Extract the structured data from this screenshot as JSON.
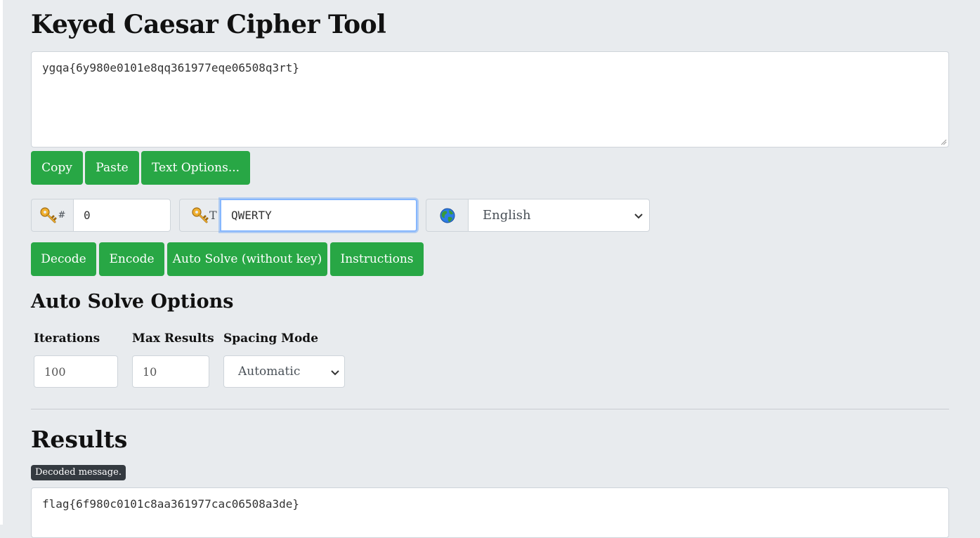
{
  "title": "Keyed Caesar Cipher Tool",
  "input": {
    "value": "ygqa{6y980e0101e8qq361977eqe06508q3rt}"
  },
  "text_buttons": {
    "copy": "Copy",
    "paste": "Paste",
    "text_options": "Text Options..."
  },
  "controls": {
    "shift_addon": "#",
    "shift_value": "0",
    "keyword_addon": "T",
    "keyword_value": "QWERTY",
    "language_selected": "English"
  },
  "action_buttons": {
    "decode": "Decode",
    "encode": "Encode",
    "auto_solve": "Auto Solve (without key)",
    "instructions": "Instructions"
  },
  "auto_solve": {
    "heading": "Auto Solve Options",
    "iterations_label": "Iterations",
    "iterations_value": "100",
    "max_results_label": "Max Results",
    "max_results_value": "10",
    "spacing_label": "Spacing Mode",
    "spacing_value": "Automatic"
  },
  "results": {
    "heading": "Results",
    "badge": "Decoded message.",
    "output": "flag{6f980c0101c8aa361977cac06508a3de}"
  },
  "colors": {
    "accent": "#28a745",
    "background": "#e8ebee",
    "focus": "#86b7fe"
  },
  "icons": {
    "shift": "key-icon",
    "keyword": "key-icon",
    "language": "globe-icon"
  }
}
